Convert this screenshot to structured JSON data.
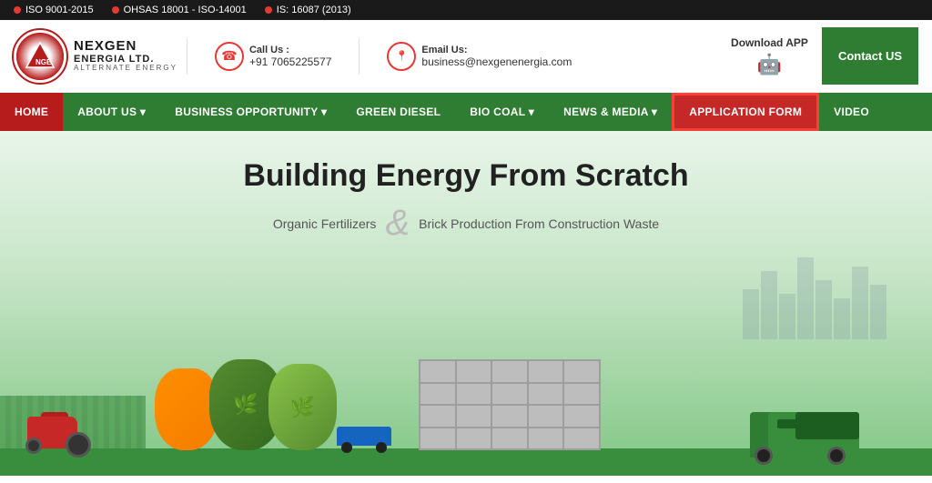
{
  "topbar": {
    "certs": [
      {
        "label": "ISO 9001-2015"
      },
      {
        "label": "OHSAS 18001 - ISO-14001"
      },
      {
        "label": "IS: 16087 (2013)"
      }
    ]
  },
  "header": {
    "logo_title": "NEXGEN",
    "logo_subtitle2": "ENERGIA LTD.",
    "logo_alt": "ALTERNATE ENERGY",
    "call_label": "Call Us :",
    "call_value": "+91 7065225577",
    "email_label": "Email Us:",
    "email_value": "business@nexgenenergia.com",
    "download_label": "Download APP",
    "contact_btn": "Contact US"
  },
  "nav": {
    "items": [
      {
        "label": "HOME",
        "active": true
      },
      {
        "label": "ABOUT US ▾",
        "dropdown": true
      },
      {
        "label": "BUSINESS OPPORTUNITY ▾",
        "dropdown": true
      },
      {
        "label": "GREEN DIESEL"
      },
      {
        "label": "BIO COAL ▾",
        "dropdown": true
      },
      {
        "label": "NEWS & MEDIA ▾",
        "dropdown": true
      },
      {
        "label": "APPLICATION FORM",
        "highlighted": true
      },
      {
        "label": "VIDEO"
      }
    ]
  },
  "hero": {
    "title": "Building Energy From Scratch",
    "subtitle_left": "Organic Fertilizers",
    "subtitle_right": "Brick Production From Construction Waste"
  }
}
